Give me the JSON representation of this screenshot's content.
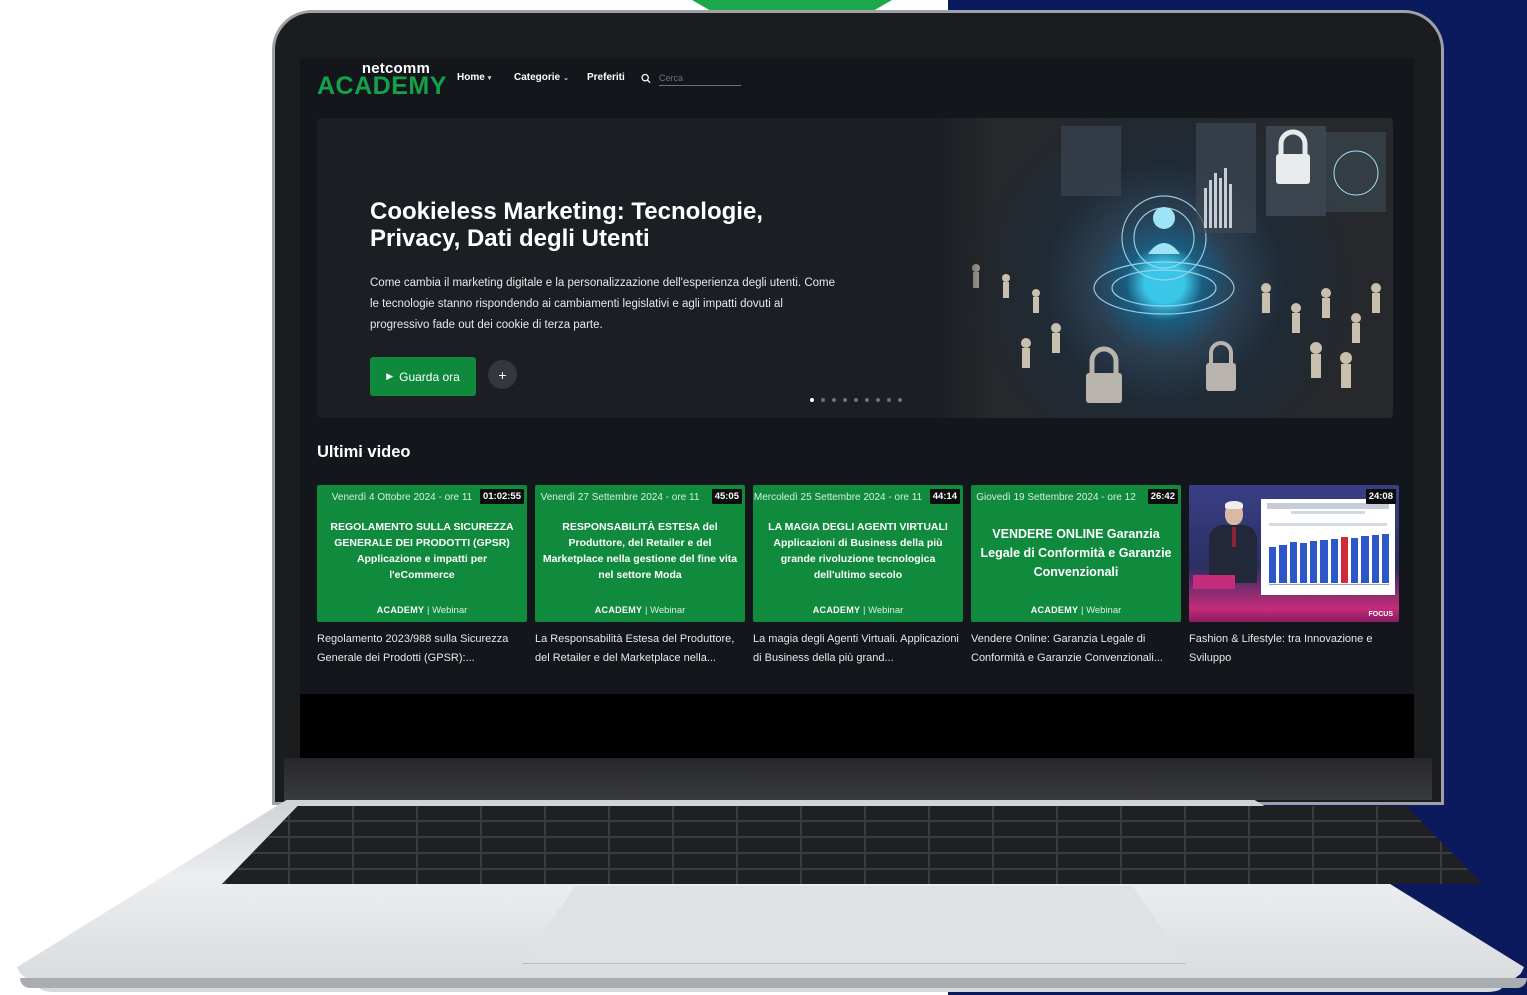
{
  "nav": {
    "logo_small": "netcomm",
    "logo_big": "ACADEMY",
    "home": "Home",
    "categories": "Categorie",
    "favorites": "Preferiti",
    "search_placeholder": "Cerca",
    "search_value": ""
  },
  "hero": {
    "title": "Cookieless Marketing: Tecnologie, Privacy, Dati degli Utenti",
    "description": "Come cambia il marketing digitale e la personalizzazione dell'esperienza degli utenti. Come le tecnologie stanno rispondendo ai cambiamenti legislativi e agli impatti dovuti al progressivo fade out dei cookie di terza parte.",
    "watch_label": "Guarda ora",
    "plus_label": "+",
    "slides_total": 9,
    "active_slide": 1
  },
  "section": {
    "title": "Ultimi video"
  },
  "cards": [
    {
      "date": "Venerdì 4 Ottobre 2024 - ore 11",
      "duration": "01:02:55",
      "thumb_lines": "REGOLAMENTO SULLA SICUREZZA GENERALE DEI PRODOTTI (GPSR) Applicazione e impatti per l'eCommerce",
      "brand": "ACADEMY",
      "brand_suffix": "Webinar",
      "title": "Regolamento 2023/988 sulla Sicurezza Generale dei Prodotti (GPSR):..."
    },
    {
      "date": "Venerdì 27 Settembre 2024 - ore 11",
      "duration": "45:05",
      "thumb_lines": "RESPONSABILITÀ ESTESA del Produttore, del Retailer e del Marketplace nella gestione del fine vita nel settore Moda",
      "brand": "ACADEMY",
      "brand_suffix": "Webinar",
      "title": "La Responsabilità Estesa del Produttore, del Retailer e del Marketplace nella..."
    },
    {
      "date": "Mercoledì 25 Settembre 2024 - ore 11",
      "duration": "44:14",
      "thumb_lines": "LA MAGIA DEGLI AGENTI VIRTUALI Applicazioni di Business della più grande rivoluzione tecnologica dell'ultimo secolo",
      "brand": "ACADEMY",
      "brand_suffix": "Webinar",
      "title": "La magia degli Agenti Virtuali. Applicazioni di Business della più grand..."
    },
    {
      "date": "Giovedì 19 Settembre 2024 - ore 12",
      "duration": "26:42",
      "thumb_lines": "VENDERE ONLINE Garanzia Legale di Conformità e Garanzie Convenzionali",
      "brand": "ACADEMY",
      "brand_suffix": "Webinar",
      "title": "Vendere Online: Garanzia Legale di Conformità e Garanzie Convenzionali..."
    },
    {
      "duration": "24:08",
      "focus": "FOCUS",
      "title": "Fashion & Lifestyle: tra Innovazione e Sviluppo"
    }
  ],
  "colors": {
    "brand_green": "#15a04a",
    "thumb_green": "#108a3d",
    "navy_bg": "#0b1a5c",
    "app_bg": "#13161a"
  }
}
